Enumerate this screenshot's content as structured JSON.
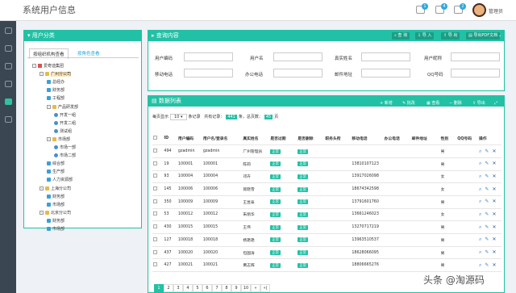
{
  "app": {
    "title": "系统用户信息"
  },
  "topbar": {
    "badges": [
      "1",
      "4",
      "2"
    ],
    "user": "管理员"
  },
  "tree": {
    "title": "用户分类",
    "tab_org": "按组织机构查看",
    "tab_role": "按角色查看",
    "nodes": [
      {
        "label": "爱奇迪集团",
        "icon": "home",
        "tog": "-"
      },
      {
        "label": "广州分公司",
        "icon": "folder",
        "tog": "-",
        "sel": true
      },
      {
        "label": "总经办",
        "icon": "leaf"
      },
      {
        "label": "财务部",
        "icon": "leaf"
      },
      {
        "label": "工程部",
        "icon": "leaf"
      },
      {
        "label": "产品研发部",
        "icon": "folder",
        "tog": "-"
      },
      {
        "label": "开发一组",
        "icon": "person"
      },
      {
        "label": "开发二组",
        "icon": "person"
      },
      {
        "label": "测试组",
        "icon": "person"
      },
      {
        "label": "市场部",
        "icon": "folder",
        "tog": "-"
      },
      {
        "label": "市场一部",
        "icon": "person"
      },
      {
        "label": "市场二部",
        "icon": "person"
      },
      {
        "label": "综合部",
        "icon": "leaf"
      },
      {
        "label": "生产部",
        "icon": "leaf"
      },
      {
        "label": "人力资源部",
        "icon": "leaf"
      },
      {
        "label": "上海分公司",
        "icon": "folder",
        "tog": "-"
      },
      {
        "label": "财务部",
        "icon": "leaf"
      },
      {
        "label": "市场部",
        "icon": "leaf"
      },
      {
        "label": "北京分公司",
        "icon": "folder",
        "tog": "-"
      },
      {
        "label": "财务部",
        "icon": "leaf"
      },
      {
        "label": "市场部",
        "icon": "leaf"
      }
    ]
  },
  "search": {
    "title": "查询内容",
    "buttons": [
      "查 询",
      "导 入",
      "导 出",
      "导出PDF文档"
    ],
    "fields": [
      "用户编码",
      "用户名",
      "真实姓名",
      "用户昵称",
      "移动电话",
      "办公电话",
      "邮件地址",
      "QQ号码"
    ]
  },
  "list": {
    "title": "数据列表",
    "buttons": [
      "新增",
      "批改",
      "查看",
      "删除",
      "导出"
    ],
    "pager_top": {
      "show": "每页显示",
      "per_page": "10",
      "records": "条记录",
      "total_pre": "共有记录：",
      "total": "441",
      "pages_pre": "条，总页数：",
      "pages": "45",
      "pages_post": "页"
    },
    "columns": [
      "ID",
      "用户编码",
      "用户名/登录名",
      "真实姓名",
      "是否过期",
      "是否删除",
      "职务头衔",
      "移动电话",
      "办公电话",
      "邮件地址",
      "性别",
      "QQ号码",
      "操作"
    ],
    "rows": [
      [
        "494",
        "gzadmin",
        "gzadmin",
        "广州管理员",
        "正常",
        "正常",
        "",
        "",
        "",
        "",
        "男",
        ""
      ],
      [
        "19",
        "100001",
        "100001",
        "陈莉",
        "正常",
        "正常",
        "",
        "13810107123",
        "",
        "",
        "男",
        ""
      ],
      [
        "93",
        "100004",
        "100004",
        "邓卉",
        "正常",
        "正常",
        "",
        "13917026098",
        "",
        "",
        "女",
        ""
      ],
      [
        "145",
        "100006",
        "100006",
        "蒋晓雪",
        "正常",
        "正常",
        "",
        "18674342598",
        "",
        "",
        "女",
        ""
      ],
      [
        "350",
        "100009",
        "100009",
        "王昱泰",
        "正常",
        "正常",
        "",
        "13791601760",
        "",
        "",
        "男",
        ""
      ],
      [
        "53",
        "100012",
        "100012",
        "朱丽华",
        "正常",
        "正常",
        "",
        "13661246023",
        "",
        "",
        "女",
        ""
      ],
      [
        "430",
        "100015",
        "100015",
        "王伟",
        "正常",
        "正常",
        "",
        "13270717219",
        "",
        "",
        "男",
        ""
      ],
      [
        "127",
        "100018",
        "100018",
        "杨艳艳",
        "正常",
        "正常",
        "",
        "13963510537",
        "",
        "",
        "男",
        ""
      ],
      [
        "437",
        "100020",
        "100020",
        "包国涛",
        "正常",
        "正常",
        "",
        "18628066095",
        "",
        "",
        "男",
        ""
      ],
      [
        "427",
        "100021",
        "100021",
        "黄志辉",
        "正常",
        "正常",
        "",
        "18806665276",
        "",
        "",
        "男",
        ""
      ]
    ],
    "pages": [
      "1",
      "2",
      "3",
      "4",
      "5",
      "6",
      "7",
      "8",
      "9",
      "10",
      "»",
      "»|"
    ]
  },
  "watermark": "头条 @淘源码"
}
